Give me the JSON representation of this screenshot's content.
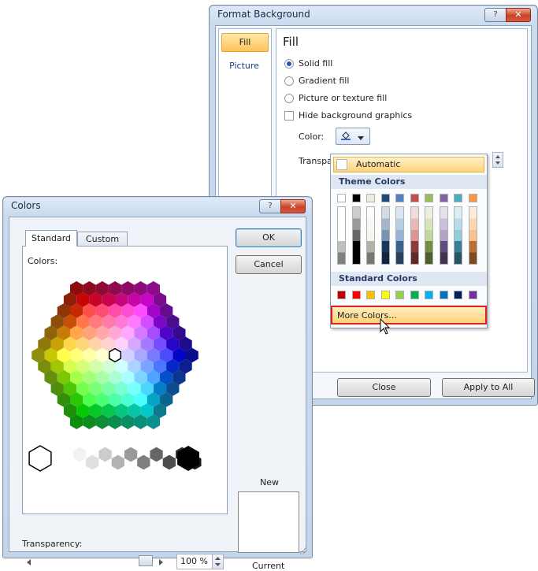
{
  "format_background": {
    "title": "Format Background",
    "help_btn": "?",
    "close_btn": "✕",
    "nav": [
      {
        "label": "Fill"
      },
      {
        "label": "Picture"
      }
    ],
    "section_title": "Fill",
    "options": {
      "solid": "Solid fill",
      "gradient": "Gradient fill",
      "picture": "Picture or texture fill",
      "hide": "Hide background graphics"
    },
    "color_label": "Color:",
    "transparency_label": "Transpa",
    "close_button": "Close",
    "apply_all_button": "Apply to All"
  },
  "color_menu": {
    "automatic": "Automatic",
    "theme_header": "Theme Colors",
    "standard_header": "Standard Colors",
    "more_colors": "More Colors...",
    "theme_top": [
      "#ffffff",
      "#000000",
      "#eeece1",
      "#1f497d",
      "#4f81bd",
      "#c0504d",
      "#9bbb59",
      "#8064a2",
      "#4bacc6",
      "#f79646"
    ],
    "standard": [
      "#c00000",
      "#ff0000",
      "#ffc000",
      "#ffff00",
      "#92d050",
      "#00b050",
      "#00b0f0",
      "#0070c0",
      "#002060",
      "#7030a0"
    ]
  },
  "colors_dialog": {
    "title": "Colors",
    "help_btn": "?",
    "close_btn": "✕",
    "tabs": [
      {
        "label": "Standard"
      },
      {
        "label": "Custom"
      }
    ],
    "colors_label": "Colors:",
    "ok": "OK",
    "cancel": "Cancel",
    "new_label": "New",
    "current_label": "Current",
    "transparency_label": "Transparency:",
    "transparency_value": "100 %"
  }
}
